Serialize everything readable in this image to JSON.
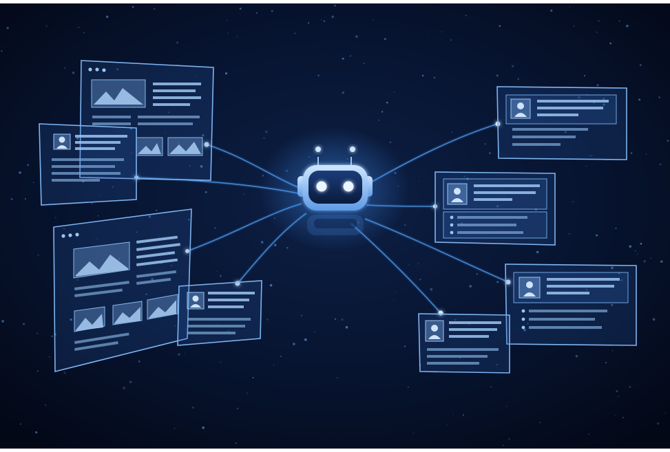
{
  "colors": {
    "background": "#040b1c",
    "glow": "#3d8ef0",
    "panel_stroke": "#7fb4f0",
    "robot_eye": "#e8f4ff"
  },
  "icons": {
    "robot": "robot-head-icon",
    "avatar": "user-avatar-icon",
    "image": "landscape-image-icon"
  }
}
